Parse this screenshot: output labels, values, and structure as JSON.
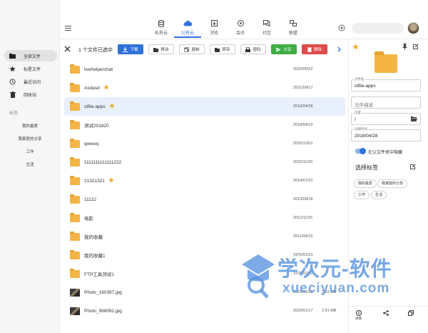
{
  "sidebar": {
    "items": [
      {
        "label": "全部文件",
        "icon": "folder-icon",
        "active": true
      },
      {
        "label": "标星文件",
        "icon": "star-icon"
      },
      {
        "label": "最近访问",
        "icon": "history-icon"
      },
      {
        "label": "回收站",
        "icon": "trash-icon"
      }
    ],
    "tags_section": "标签",
    "tags": [
      "我的最爱",
      "我家庭的分享",
      "工作",
      "生活"
    ]
  },
  "nav": {
    "tabs": [
      {
        "label": "私有云",
        "icon": "database-icon"
      },
      {
        "label": "公有云",
        "icon": "cloud-icon",
        "active": true
      },
      {
        "label": "浏览",
        "icon": "browse-icon"
      },
      {
        "label": "会员",
        "icon": "member-icon"
      },
      {
        "label": "社区",
        "icon": "chat-icon"
      },
      {
        "label": "联盟",
        "icon": "network-icon"
      }
    ]
  },
  "actions": {
    "selection_text": "1 个文件已选中",
    "download": "下载",
    "move": "移动",
    "copy": "复制",
    "save": "转存",
    "password": "密码",
    "share": "分享",
    "delete": "删除"
  },
  "files": [
    {
      "name": "livehelperchat",
      "date": "2022/05/22",
      "size": "",
      "type": "folder",
      "starred": false
    },
    {
      "name": "Asdasd",
      "date": "2021/09/17",
      "size": "",
      "type": "folder",
      "starred": true
    },
    {
      "name": "ctfile-apps",
      "date": "2018/04/28",
      "size": "",
      "type": "folder",
      "starred": true,
      "selected": true
    },
    {
      "name": "测试201820",
      "date": "2018/04/10",
      "size": "",
      "type": "folder",
      "starred": false
    },
    {
      "name": "qwewq",
      "date": "2015/12/01",
      "size": "",
      "type": "folder",
      "starred": false
    },
    {
      "name": "1111111111111222",
      "date": "2015/11/20",
      "size": "",
      "type": "folder",
      "starred": false
    },
    {
      "name": "21321321",
      "date": "2014/07/31",
      "size": "",
      "type": "folder",
      "starred": true
    },
    {
      "name": "11122",
      "date": "2013/09/18",
      "size": "",
      "type": "folder",
      "starred": false
    },
    {
      "name": "电影",
      "date": "2012/11/16",
      "size": "",
      "type": "folder",
      "starred": false
    },
    {
      "name": "我的收藏",
      "date": "2011/09/13",
      "size": "",
      "type": "folder",
      "starred": false
    },
    {
      "name": "我的收藏1",
      "date": "1970/01/01",
      "size": "",
      "type": "folder",
      "starred": false
    },
    {
      "name": "FTP工具测试1",
      "date": "1970/01/01",
      "size": "",
      "type": "folder",
      "starred": false
    },
    {
      "name": "Photo_160397.jpg",
      "date": "2023/01/18",
      "size": "2.81 MB",
      "type": "image",
      "starred": false
    },
    {
      "name": "Photo_968091.jpg",
      "date": "2023/01/17",
      "size": "2.51 MB",
      "type": "image",
      "starred": false
    }
  ],
  "details": {
    "name_label": "文件名",
    "name_value": "ctfile-apps",
    "desc_placeholder": "文件描述",
    "location_label": "位置",
    "location_value": "/",
    "created_label": "创建时间",
    "created_value": "2018/04/28",
    "hide_toggle_label": "在父文件夹中隐藏",
    "tags_title": "选择标签",
    "tags": [
      "我的最爱",
      "我家庭的分享",
      "工作",
      "生活"
    ],
    "bottom": {
      "details": "详情"
    }
  },
  "watermark": {
    "title": "学次元-软件",
    "url": "xueciyuan.com"
  },
  "colors": {
    "accent": "#2f73d8",
    "folder": "#f4b545",
    "star": "#f0a92a",
    "share": "#3fae45",
    "delete": "#e04b4b"
  }
}
